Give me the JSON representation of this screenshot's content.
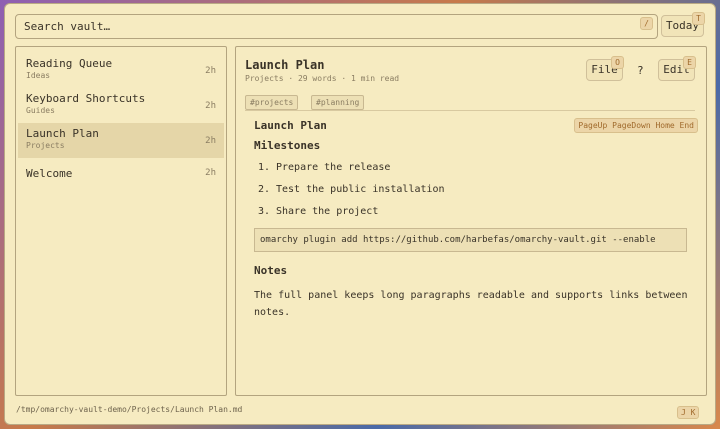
{
  "search": {
    "placeholder": "Search vault…",
    "shortcut": "/"
  },
  "header": {
    "today_label": "Today",
    "today_shortcut": "T"
  },
  "sidebar": {
    "items": [
      {
        "title": "Reading Queue",
        "folder": "Ideas",
        "age": "2h"
      },
      {
        "title": "Keyboard Shortcuts",
        "folder": "Guides",
        "age": "2h"
      },
      {
        "title": "Launch Plan",
        "folder": "Projects",
        "age": "2h"
      },
      {
        "title": "Welcome",
        "folder": "",
        "age": "2h"
      }
    ]
  },
  "note": {
    "title": "Launch Plan",
    "meta": "Projects · 29 words · 1 min read",
    "tags": [
      "#projects",
      "#planning"
    ],
    "file_label": "File",
    "file_shortcut": "O",
    "help_label": "?",
    "edit_label": "Edit",
    "edit_shortcut": "E",
    "content_title": "Launch Plan",
    "nav_keys": "PageUp PageDown Home End",
    "milestones_heading": "Milestones",
    "milestones": [
      "Prepare the release",
      "Test the public installation",
      "Share the project"
    ],
    "code": "omarchy plugin add https://github.com/harbefas/omarchy-vault.git --enable",
    "notes_heading": "Notes",
    "notes_text": "The full panel keeps long paragraphs readable and supports links between notes."
  },
  "status": {
    "path": "/tmp/omarchy-vault-demo/Projects/Launch Plan.md",
    "nav_keys": "J K"
  },
  "colors": {
    "background": "#f6ebc1",
    "accent": "#a06a2c",
    "selected": "#e5d6a8"
  }
}
